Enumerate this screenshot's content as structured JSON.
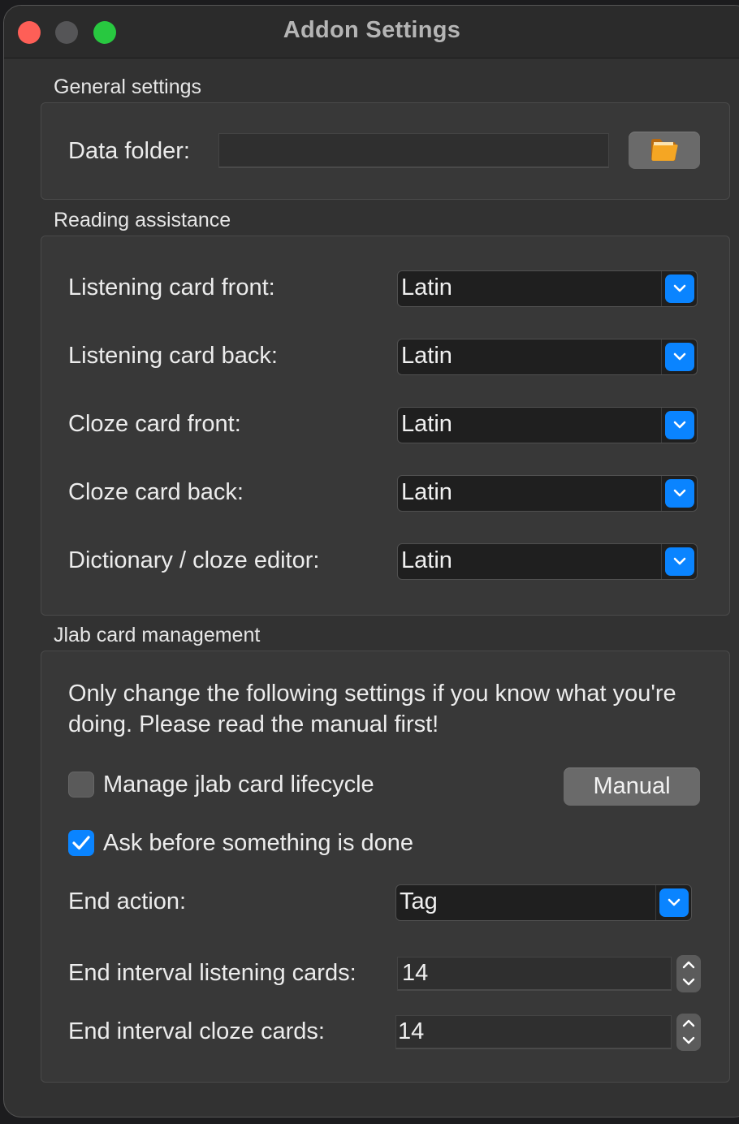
{
  "window": {
    "title": "Addon Settings",
    "traffic_lights": [
      "close",
      "minimize",
      "zoom"
    ]
  },
  "general": {
    "title": "General settings",
    "data_folder_label": "Data folder:",
    "data_folder_value": "",
    "folder_icon": "folder-icon"
  },
  "reading": {
    "title": "Reading assistance",
    "rows": [
      {
        "label": "Listening card front:",
        "value": "Latin"
      },
      {
        "label": "Listening card back:",
        "value": "Latin"
      },
      {
        "label": "Cloze card front:",
        "value": "Latin"
      },
      {
        "label": "Cloze card back:",
        "value": "Latin"
      },
      {
        "label": "Dictionary / cloze editor:",
        "value": "Latin"
      }
    ]
  },
  "jlab": {
    "title": "Jlab card management",
    "warning": "Only change the following settings if you know what you're doing. Please read the manual first!",
    "manage_lifecycle": {
      "label": "Manage jlab card lifecycle",
      "checked": false
    },
    "manual_button": "Manual",
    "ask_before": {
      "label": "Ask before something is done",
      "checked": true
    },
    "end_action": {
      "label": "End action:",
      "value": "Tag"
    },
    "end_interval_listening": {
      "label": "End interval listening cards:",
      "value": "14"
    },
    "end_interval_cloze": {
      "label": "End interval cloze cards:",
      "value": "14"
    }
  },
  "colors": {
    "accent": "#0a84ff",
    "window_bg": "#323232",
    "group_bg": "#383838",
    "close": "#fe5f57",
    "zoom": "#28c840"
  }
}
